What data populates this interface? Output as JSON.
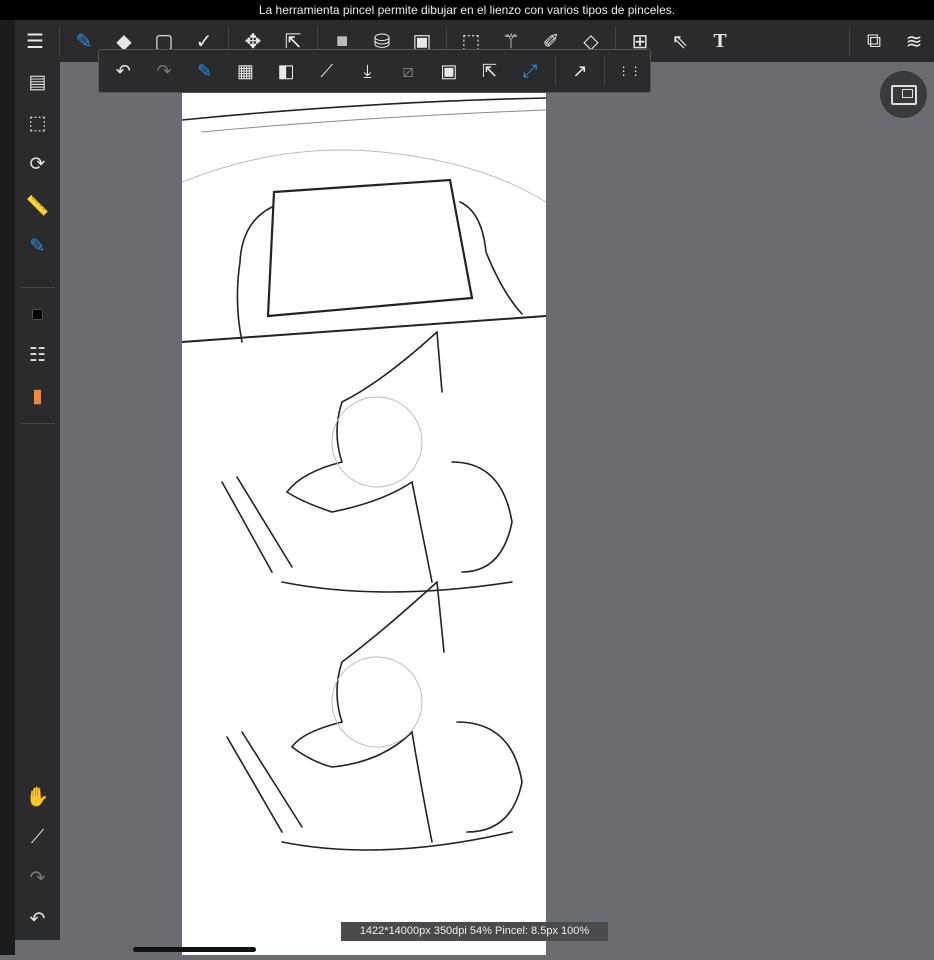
{
  "status_bar": {
    "tooltip": "La herramienta pincel permite dibujar en el lienzo con varios tipos de pinceles."
  },
  "toolbar": {
    "menu": "☰",
    "tools": [
      {
        "name": "brush",
        "glyph": "✎"
      },
      {
        "name": "eraser",
        "glyph": "◆"
      },
      {
        "name": "shape",
        "glyph": "▢"
      },
      {
        "name": "edit",
        "glyph": "✓"
      },
      {
        "name": "move",
        "glyph": "✥"
      },
      {
        "name": "transform",
        "glyph": "⇱"
      },
      {
        "name": "fill",
        "glyph": "■"
      },
      {
        "name": "bucket",
        "glyph": "⛁"
      },
      {
        "name": "gradient",
        "glyph": "▣"
      },
      {
        "name": "select",
        "glyph": "⬚"
      },
      {
        "name": "magic-wand",
        "glyph": "⚚"
      },
      {
        "name": "select-pen",
        "glyph": "✐"
      },
      {
        "name": "select-eraser",
        "glyph": "◇"
      },
      {
        "name": "frame",
        "glyph": "⊞"
      },
      {
        "name": "operation",
        "glyph": "⇖"
      },
      {
        "name": "text",
        "glyph": "T"
      }
    ],
    "materials": "⧉",
    "layers": "≋"
  },
  "subtoolbar": {
    "items": [
      {
        "name": "undo",
        "glyph": "↶"
      },
      {
        "name": "redo",
        "glyph": "↷"
      },
      {
        "name": "brush-stabilizer",
        "glyph": "✎"
      },
      {
        "name": "transparency",
        "glyph": "▦"
      },
      {
        "name": "color-swap",
        "glyph": "◧"
      },
      {
        "name": "eyedropper",
        "glyph": "⟋"
      },
      {
        "name": "save",
        "glyph": "⤓"
      },
      {
        "name": "snap-off",
        "glyph": "⧄"
      },
      {
        "name": "clip",
        "glyph": "▣"
      },
      {
        "name": "export",
        "glyph": "⇱"
      },
      {
        "name": "fullscreen",
        "glyph": "⤢"
      },
      {
        "name": "share",
        "glyph": "↗"
      },
      {
        "name": "more",
        "glyph": "⋮⋮"
      }
    ]
  },
  "sidebar": {
    "top": [
      {
        "name": "pages",
        "glyph": "▤"
      },
      {
        "name": "selection-menu",
        "glyph": "⬚"
      },
      {
        "name": "rotate",
        "glyph": "⟳"
      },
      {
        "name": "ruler",
        "glyph": "📏"
      },
      {
        "name": "brush-settings",
        "glyph": "✎"
      }
    ],
    "colors": [
      {
        "name": "color",
        "glyph": "■"
      },
      {
        "name": "brush-list",
        "glyph": "☷"
      },
      {
        "name": "color-palette",
        "glyph": "▮"
      }
    ],
    "bottom": [
      {
        "name": "hand",
        "glyph": "✋"
      },
      {
        "name": "eyedropper",
        "glyph": "⟋"
      },
      {
        "name": "redo",
        "glyph": "↷"
      },
      {
        "name": "undo",
        "glyph": "↶"
      }
    ]
  },
  "info_bar": {
    "text": "1422*14000px 350dpi 54% Pincel: 8.5px 100%"
  }
}
